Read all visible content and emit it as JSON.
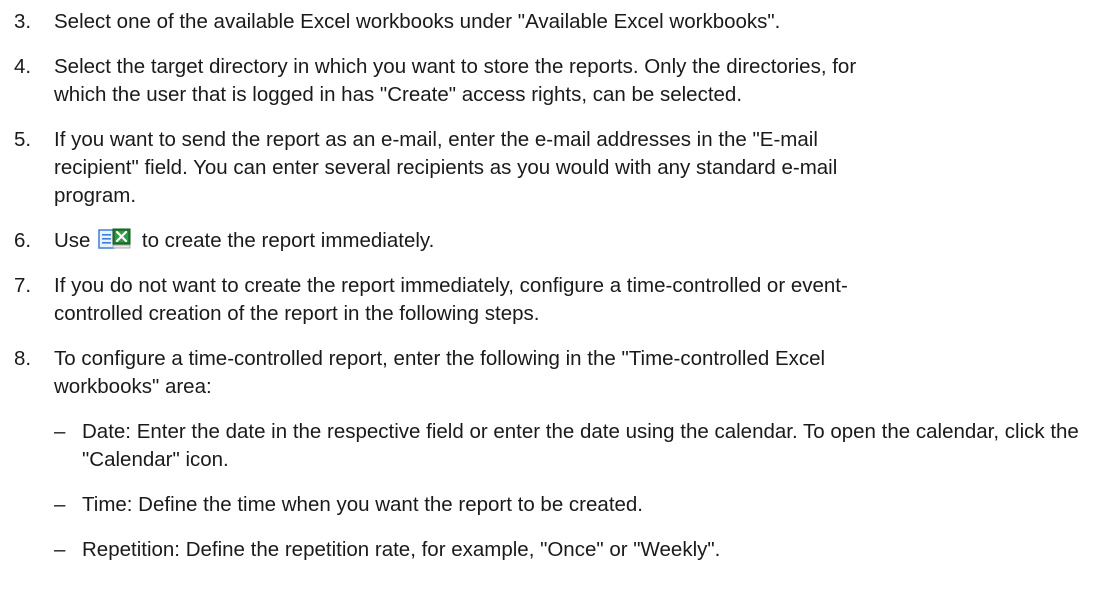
{
  "steps": [
    {
      "num": "3.",
      "lines": [
        "Select one of the available Excel workbooks under \"Available Excel workbooks\"."
      ]
    },
    {
      "num": "4.",
      "lines": [
        "Select the target directory in which you want to store the reports. Only the directories, for",
        "which the user that is logged in has \"Create\" access rights, can be selected."
      ]
    },
    {
      "num": "5.",
      "lines": [
        "If you want to send the report as an e-mail, enter the e-mail addresses in the \"E-mail",
        "recipient\" field. You can enter several recipients as you would with any standard e-mail",
        "program."
      ]
    },
    {
      "num": "6.",
      "before_icon": "Use",
      "icon": "excel-report-icon",
      "after_icon": "to create the report immediately."
    },
    {
      "num": "7.",
      "lines": [
        "If you do not want to create the report immediately, configure a time-controlled or event-",
        "controlled creation of the report in the following steps."
      ]
    },
    {
      "num": "8.",
      "lines": [
        "To configure a time-controlled report, enter the following in the \"Time-controlled Excel",
        "workbooks\" area:"
      ]
    }
  ],
  "sub_items": [
    {
      "dash": "–",
      "lines": [
        "Date: Enter the date in the respective field or enter the date using the calendar. To open",
        "the calendar, click the \"Calendar\" icon."
      ]
    },
    {
      "dash": "–",
      "lines": [
        "Time: Define the time when you want the report to be created."
      ]
    },
    {
      "dash": "–",
      "lines": [
        "Repetition: Define the repetition rate, for example, \"Once\" or \"Weekly\"."
      ]
    }
  ],
  "colors": {
    "text": "#1a1a1a",
    "excel_green": "#1f7a2e",
    "doc_blue": "#3d7fd6"
  }
}
